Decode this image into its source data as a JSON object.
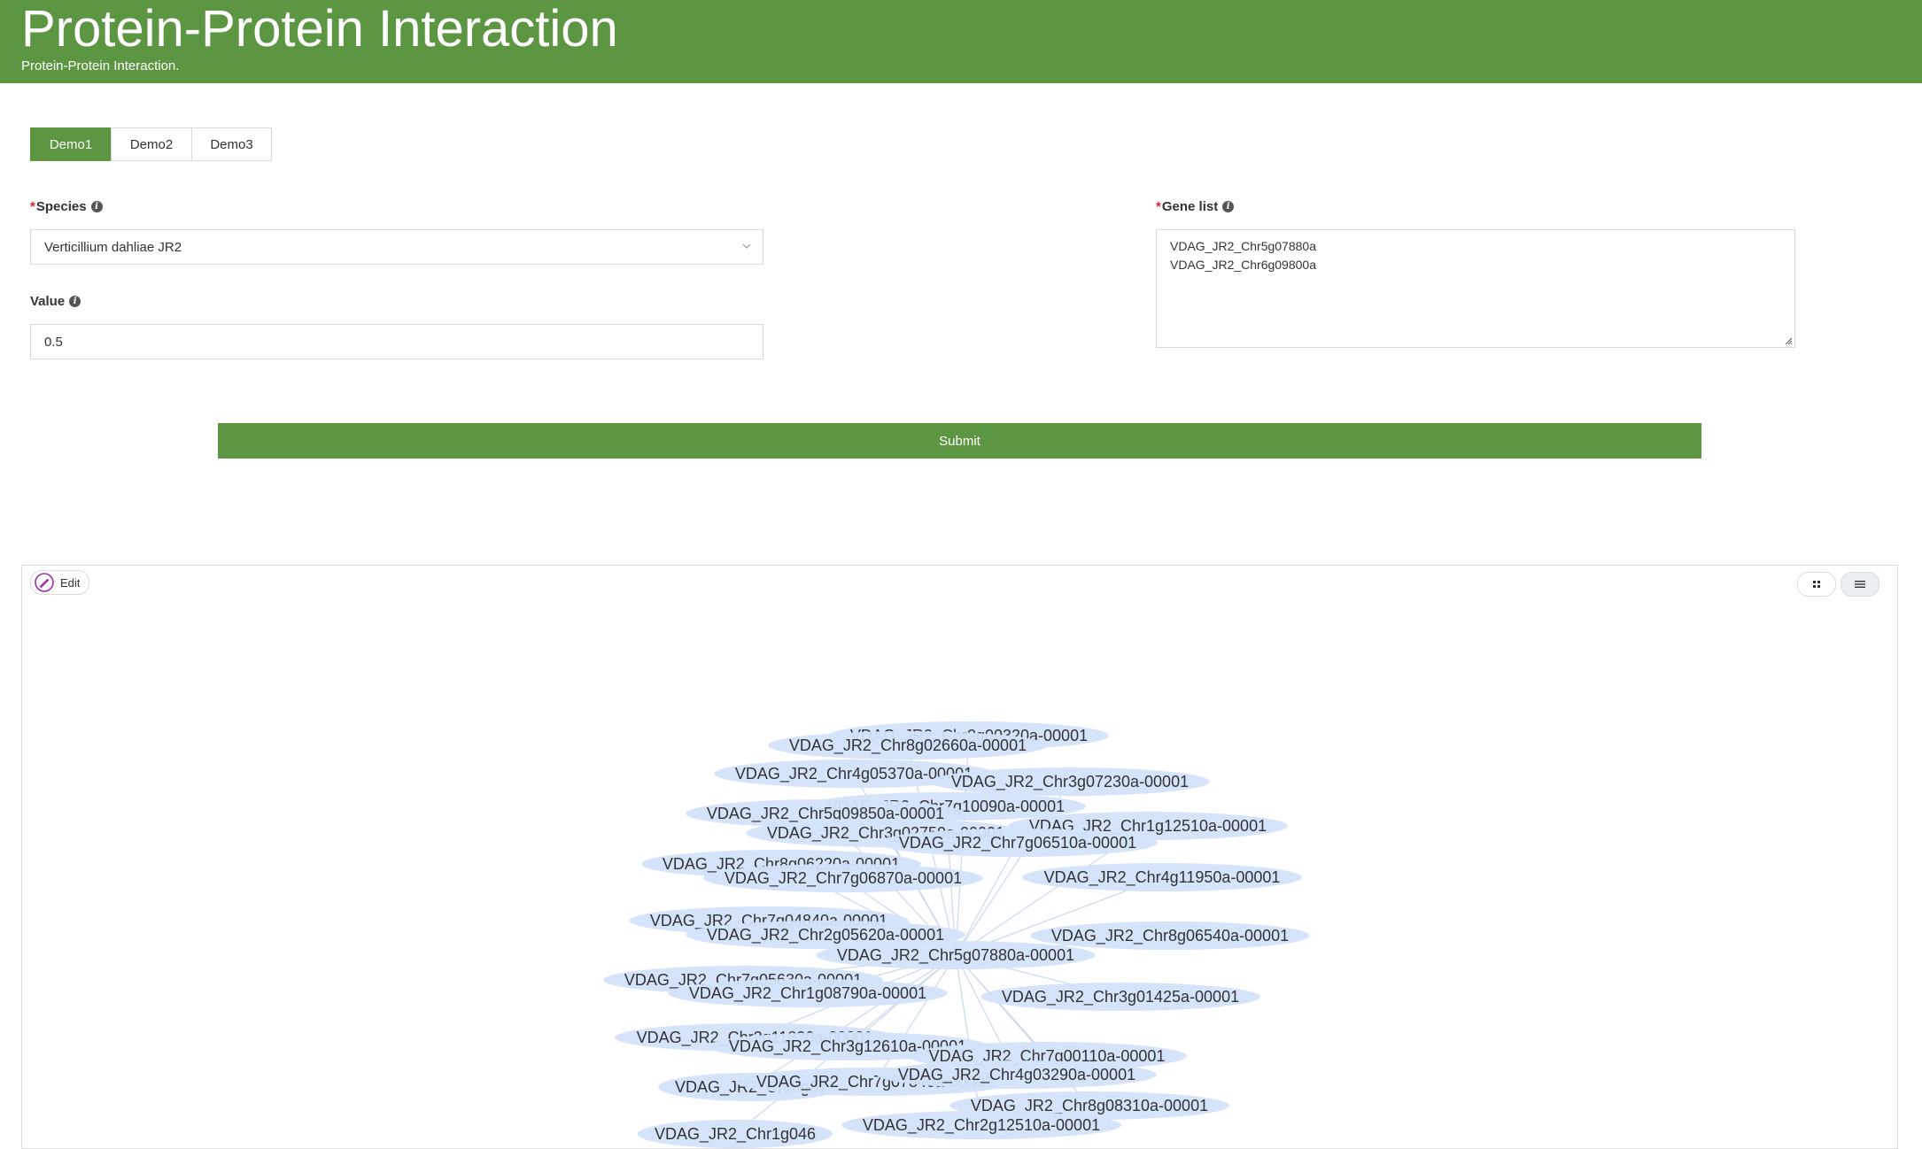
{
  "header": {
    "title": "Protein-Protein Interaction",
    "subtitle": "Protein-Protein Interaction."
  },
  "tabs": [
    {
      "label": "Demo1",
      "active": true
    },
    {
      "label": "Demo2",
      "active": false
    },
    {
      "label": "Demo3",
      "active": false
    }
  ],
  "form": {
    "species_label": "Species",
    "species_value": "Verticillium dahliae JR2",
    "value_label": "Value",
    "value_value": "0.5",
    "gene_list_label": "Gene list",
    "gene_list_value": "VDAG_JR2_Chr5g07880a\nVDAG_JR2_Chr6g09800a",
    "required_mark": "*",
    "submit_label": "Submit"
  },
  "panel": {
    "edit_label": "Edit",
    "grid_icon": "grid-view-icon",
    "list_icon": "list-view-icon"
  },
  "colors": {
    "brand": "#5c9642",
    "node_fill": "#d3e3fb",
    "edge": "#c9d9ee"
  },
  "network": {
    "center": "VDAG_JR2_Chr5g07880a-00001",
    "nodes": [
      "VDAG_JR2_Chr2g00320a-00001",
      "VDAG_JR2_Chr8g02660a-00001",
      "VDAG_JR2_Chr4g05370a-00001",
      "VDAG_JR2_Chr3g07230a-00001",
      "VDAG_JR2_Chr7g10090a-00001",
      "VDAG_JR2_Chr5g09850a-00001",
      "VDAG_JR2_Chr1g12510a-00001",
      "VDAG_JR2_Chr3g02750a-00001",
      "VDAG_JR2_Chr7g06510a-00001",
      "VDAG_JR2_Chr8g06220a-00001",
      "VDAG_JR2_Chr7g06870a-00001",
      "VDAG_JR2_Chr4g11950a-00001",
      "VDAG_JR2_Chr7g04840a-00001",
      "VDAG_JR2_Chr2g05620a-00001",
      "VDAG_JR2_Chr8g06540a-00001",
      "VDAG_JR2_Chr5g07880a-00001",
      "VDAG_JR2_Chr7g05630a-00001",
      "VDAG_JR2_Chr1g08790a-00001",
      "VDAG_JR2_Chr3g01425a-00001",
      "VDAG_JR2_Chr2g11830a-00001",
      "VDAG_JR2_Chr3g12610a-00001",
      "VDAG_JR2_Chr7g00110a-00001",
      "VDAG_JR2_Chr6g07",
      "VDAG_JR2_Chr7g07840a-00001",
      "VDAG_JR2_Chr4g03290a-00001",
      "VDAG_JR2_Chr8g08310a-00001",
      "VDAG_JR2_Chr1g046",
      "VDAG_JR2_Chr2g12510a-00001"
    ]
  }
}
